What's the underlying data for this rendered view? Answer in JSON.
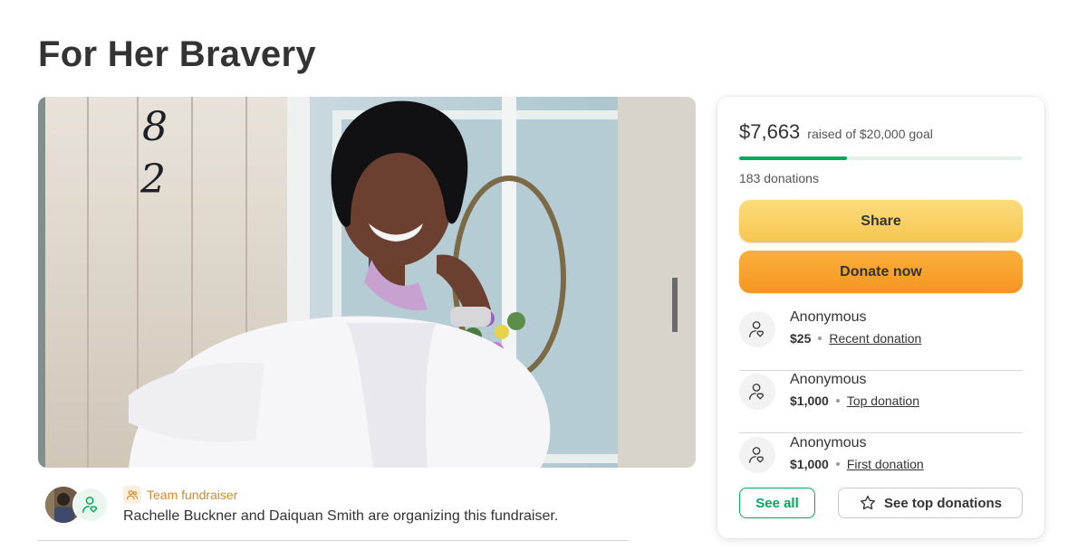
{
  "page": {
    "title": "For Her Bravery"
  },
  "hero": {
    "house_number": [
      "8",
      "2"
    ]
  },
  "organizer": {
    "badge_label": "Team fundraiser",
    "text": "Rachelle Buckner and Daiquan Smith are organizing this fundraiser."
  },
  "summary": {
    "raised_amount": "$7,663",
    "goal_text": "raised of $20,000 goal",
    "progress_fraction": 0.38,
    "donation_count": "183 donations"
  },
  "actions": {
    "share_label": "Share",
    "donate_label": "Donate now"
  },
  "donations": [
    {
      "name": "Anonymous",
      "amount": "$25",
      "tag": "Recent donation"
    },
    {
      "name": "Anonymous",
      "amount": "$1,000",
      "tag": "Top donation"
    },
    {
      "name": "Anonymous",
      "amount": "$1,000",
      "tag": "First donation"
    }
  ],
  "footer_buttons": {
    "see_all_label": "See all",
    "see_top_label": "See top donations"
  },
  "colors": {
    "accent_green": "#02a95c",
    "share_yellow": "#f6c64f",
    "donate_orange": "#f59523",
    "team_badge": "#d38b2c"
  },
  "icons": {
    "donor": "user-heart-icon",
    "team": "people-icon",
    "star": "star-icon"
  }
}
